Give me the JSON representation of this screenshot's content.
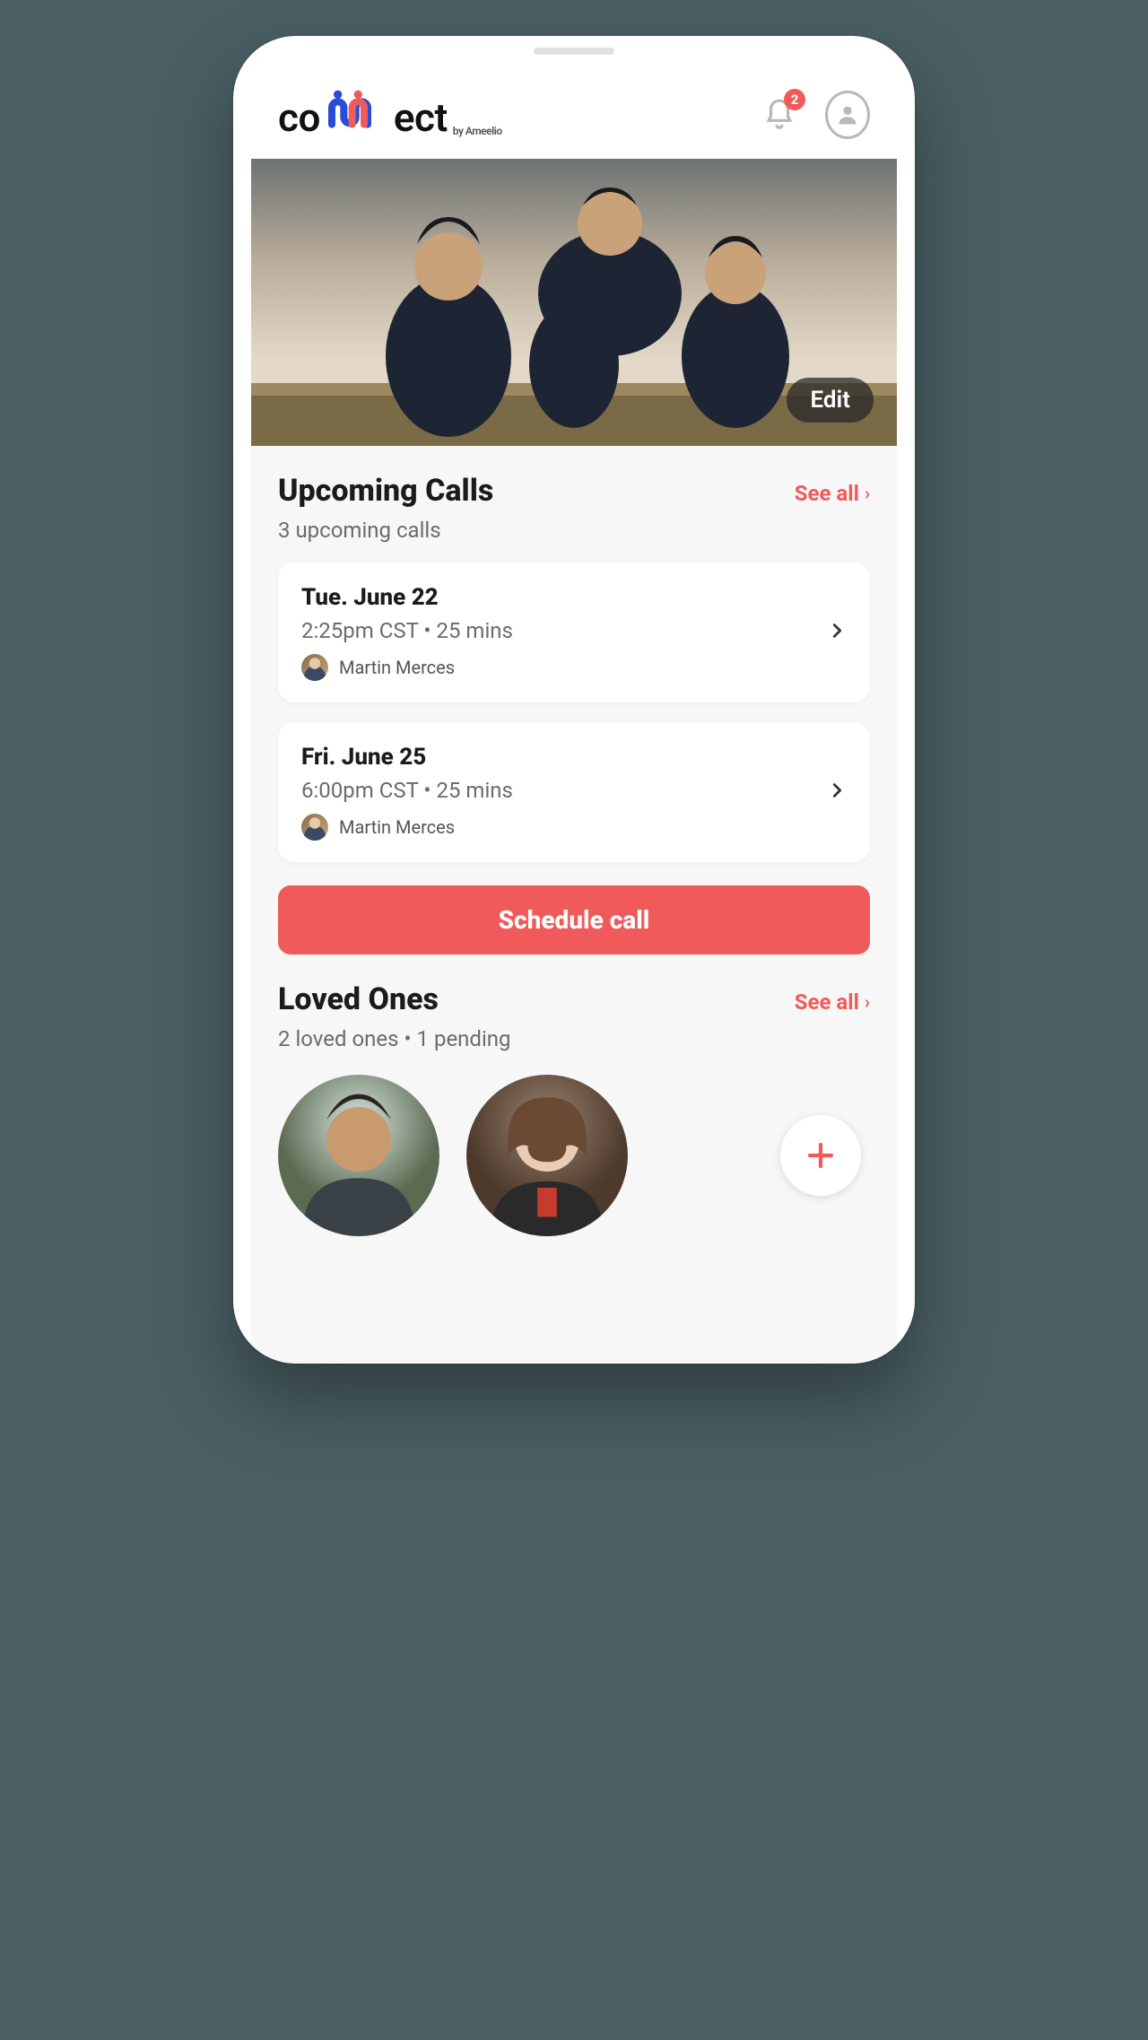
{
  "header": {
    "brand_prefix": "co",
    "brand_suffix": "ect",
    "brand_sub": "by Ameelio",
    "notification_count": "2"
  },
  "hero": {
    "edit_label": "Edit"
  },
  "upcoming": {
    "title": "Upcoming Calls",
    "see_all": "See all",
    "subtitle": "3 upcoming calls",
    "calls": [
      {
        "date": "Tue. June 22",
        "time": "2:25pm CST • 25 mins",
        "contact": "Martin Merces"
      },
      {
        "date": "Fri. June 25",
        "time": "6:00pm CST • 25 mins",
        "contact": "Martin Merces"
      }
    ],
    "schedule_label": "Schedule call"
  },
  "loved": {
    "title": "Loved Ones",
    "see_all": "See all",
    "subtitle": "2 loved ones • 1 pending"
  },
  "colors": {
    "accent": "#f05a5a"
  }
}
